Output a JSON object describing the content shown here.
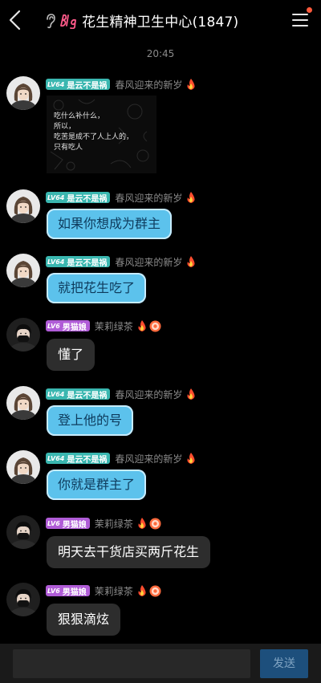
{
  "header": {
    "title": "花生精神卫生中心(1847)",
    "back_icon": "chevron-left-icon",
    "menu_icon": "hamburger-menu-icon",
    "notification_dot_color": "#ff5a3c"
  },
  "timestamp": "20:45",
  "messages": [
    {
      "sender": "是云不是祸",
      "level": "LV64",
      "subtitle": "春风迎来的新岁",
      "type": "image",
      "image_text": [
        "吃什么补什么，",
        "所以，",
        "吃苦是成不了人上人的，",
        "只有吃人"
      ]
    },
    {
      "sender": "是云不是祸",
      "level": "LV64",
      "subtitle": "春风迎来的新岁",
      "type": "text",
      "text": "如果你想成为群主"
    },
    {
      "sender": "是云不是祸",
      "level": "LV64",
      "subtitle": "春风迎来的新岁",
      "type": "text",
      "text": "就把花生吃了"
    },
    {
      "sender": "男猫娘",
      "level": "LV6",
      "subtitle": "茉莉绿茶",
      "type": "text",
      "text": "懂了"
    },
    {
      "sender": "是云不是祸",
      "level": "LV64",
      "subtitle": "春风迎来的新岁",
      "type": "text",
      "text": "登上他的号"
    },
    {
      "sender": "是云不是祸",
      "level": "LV64",
      "subtitle": "春风迎来的新岁",
      "type": "text",
      "text": "你就是群主了"
    },
    {
      "sender": "男猫娘",
      "level": "LV6",
      "subtitle": "茉莉绿茶",
      "type": "text",
      "text": "明天去干货店买两斤花生"
    },
    {
      "sender": "男猫娘",
      "level": "LV6",
      "subtitle": "茉莉绿茶",
      "type": "text",
      "text": "狠狠滴炫"
    }
  ],
  "composer": {
    "input_value": "",
    "send_label": "发送"
  },
  "colors": {
    "teal_tag": "#3ab7b0",
    "purple_tag": "#b05cd7",
    "blue_bubble": "#5cc2ec",
    "gray_bubble": "#2d2d2d",
    "send_button": "#1d4f7c"
  }
}
